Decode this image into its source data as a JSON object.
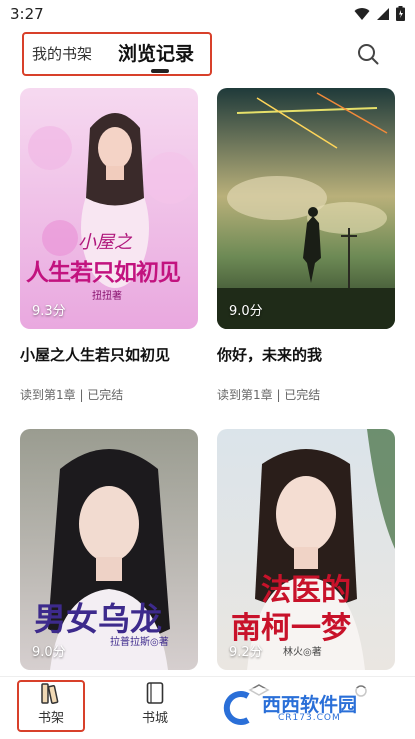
{
  "status_bar": {
    "time": "3:27"
  },
  "tabs": {
    "shelf_label": "我的书架",
    "history_label": "浏览记录"
  },
  "books": [
    {
      "title": "小屋之人生若只如初见",
      "score": "9.3分",
      "progress": "读到第1章 | 已完结",
      "cover_title_small": "小屋之",
      "cover_title": "人生若只如初见",
      "cover_author": "扭扭著"
    },
    {
      "title": "你好，未来的我",
      "score": "9.0分",
      "progress": "读到第1章 | 已完结"
    },
    {
      "title": "男女乌龙",
      "score": "9.0分",
      "cover_title": "男女乌龙",
      "cover_author": "拉普拉斯◎著"
    },
    {
      "title": "法医的南柯一梦",
      "score": "9.2分",
      "cover_title_line1": "法医的",
      "cover_title_line2": "南柯一梦",
      "cover_author": "林火◎著"
    }
  ],
  "nav": {
    "shelf": "书架",
    "store": "书城"
  },
  "watermark": {
    "brand": "西西软件园",
    "url": "CR173.COM"
  },
  "colors": {
    "accent_red": "#d8402a"
  }
}
